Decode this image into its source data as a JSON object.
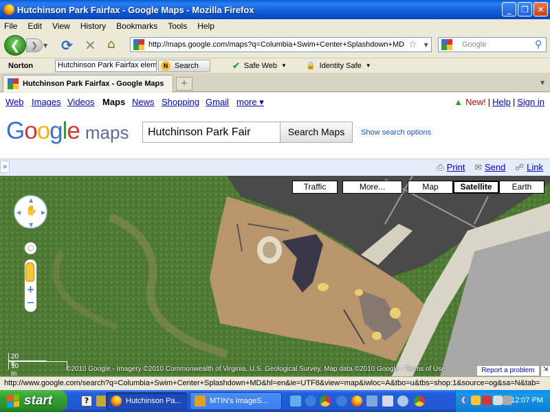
{
  "window": {
    "title": "Hutchinson Park Fairfax - Google Maps - Mozilla Firefox",
    "min": "_",
    "max": "❐",
    "close": "✕"
  },
  "menu": [
    "File",
    "Edit",
    "View",
    "History",
    "Bookmarks",
    "Tools",
    "Help"
  ],
  "nav": {
    "url": "http://maps.google.com/maps?q=Columbia+Swim+Center+Splashdown+MD",
    "search_placeholder": "Google"
  },
  "norton": {
    "logo": "Norton",
    "input_value": "Hutchinson Park Fairfax elem",
    "search_label": "Search",
    "safe_web": "Safe Web",
    "identity_safe": "Identity Safe"
  },
  "tab": {
    "title": "Hutchinson Park Fairfax - Google Maps",
    "new_tab": "+"
  },
  "gbar": {
    "links": [
      "Web",
      "Images",
      "Videos",
      "Maps",
      "News",
      "Shopping",
      "Gmail",
      "more ▾"
    ],
    "new": "New!",
    "help": "Help",
    "signin": "Sign in"
  },
  "search": {
    "logo_google": "Google",
    "logo_maps": "maps",
    "query": "Hutchinson Park Fair",
    "button": "Search Maps",
    "options": "Show search options"
  },
  "strip": {
    "collapse": "»",
    "print": "Print",
    "send": "Send",
    "link": "Link"
  },
  "map": {
    "types": [
      "Traffic",
      "More...",
      "Map",
      "Satellite",
      "Earth"
    ],
    "selected_type": "Satellite",
    "scale_ft": "20 ft",
    "scale_m": "10 m",
    "copyright": "©2010 Google - Imagery ©2010 Commonwealth of Virginia, U.S. Geological Survey, Map data ©2010 Google - Terms of Use",
    "report": "Report a problem"
  },
  "status": "http://www.google.com/search?q=Columbia+Swim+Center+Splashdown+MD&hl=en&ie=UTF8&view=map&iwloc=A&tbo=u&tbs=shop:1&source=og&sa=N&tab=",
  "taskbar": {
    "start": "start",
    "tasks": [
      "Hutchinson Pa...",
      "MTIN's ImageS..."
    ],
    "clock": "12:07 PM"
  },
  "colors": {
    "titlebar": "#0a55d2",
    "grass": "#4e7a34",
    "woodchips": "#b8956a",
    "pavement": "#444444",
    "link": "#0000cc"
  }
}
